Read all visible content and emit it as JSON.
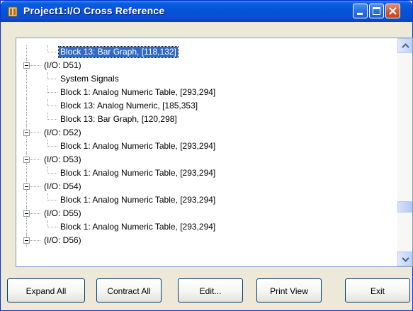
{
  "window": {
    "title": "Project1:I/O Cross Reference"
  },
  "tree": {
    "rows": [
      {
        "type": "child",
        "label": "Block 13: Bar Graph, [118,132]",
        "selected": true
      },
      {
        "type": "parent",
        "label": "(I/O: D51)"
      },
      {
        "type": "child",
        "label": "System Signals"
      },
      {
        "type": "child",
        "label": "Block 1: Analog Numeric Table, [293,294]"
      },
      {
        "type": "child",
        "label": "Block 13: Analog Numeric, [185,353]"
      },
      {
        "type": "child",
        "label": "Block 13: Bar Graph, [120,298]"
      },
      {
        "type": "parent",
        "label": "(I/O: D52)"
      },
      {
        "type": "child",
        "label": "Block 1: Analog Numeric Table, [293,294]"
      },
      {
        "type": "parent",
        "label": "(I/O: D53)"
      },
      {
        "type": "child",
        "label": "Block 1: Analog Numeric Table, [293,294]"
      },
      {
        "type": "parent",
        "label": "(I/O: D54)"
      },
      {
        "type": "child",
        "label": "Block 1: Analog Numeric Table, [293,294]"
      },
      {
        "type": "parent",
        "label": "(I/O: D55)"
      },
      {
        "type": "child",
        "label": "Block 1: Analog Numeric Table, [293,294]"
      },
      {
        "type": "parent",
        "label": "(I/O: D56)"
      }
    ]
  },
  "buttons": {
    "expand_all": "Expand All",
    "contract_all": "Contract All",
    "edit": "Edit...",
    "print_view": "Print View",
    "exit": "Exit"
  },
  "colors": {
    "titlebar": "#0553d8",
    "selection": "#316ac5",
    "window_face": "#ece9d8"
  }
}
